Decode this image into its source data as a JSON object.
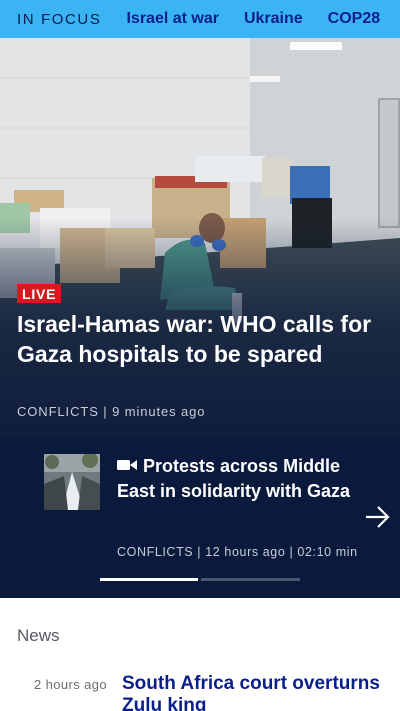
{
  "focus_bar": {
    "label": "IN FOCUS",
    "links": [
      "Israel at war",
      "Ukraine",
      "COP28"
    ],
    "bg_color": "#3ab4f2"
  },
  "hero": {
    "badge": "LIVE",
    "title": "Israel-Hamas war: WHO calls for Gaza hospitals to be spared",
    "meta": "CONFLICTS | 9 minutes ago",
    "badge_color": "#d71920"
  },
  "carousel": {
    "icon": "video-camera-icon",
    "title": "Protests across Middle East in solidarity with Gaza",
    "meta": "CONFLICTS | 12 hours ago | 02:10 min",
    "next_icon": "arrow-right-icon",
    "pages_total": 2,
    "page_active": 1
  },
  "news": {
    "header": "News",
    "items": [
      {
        "time": "2 hours ago",
        "title": "South Africa court overturns Zulu king"
      }
    ]
  }
}
